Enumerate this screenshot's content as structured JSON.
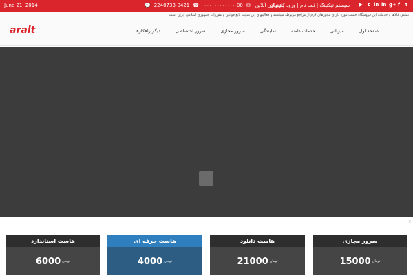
{
  "topbar": {
    "date": "June 21, 2014",
    "support": "پشتیبانی آنلاین",
    "phone": "00-۰۰۰۰۰۰۰۰۰۰۰۰",
    "phone2": "0421-2240733",
    "login": "سیستم تیکتینگ | ثبت نام | ورود کاربران",
    "social_icons": [
      "youtube-icon",
      "tumblr-icon",
      "linkedin-icon",
      "linkedin-icon",
      "google-plus-icon",
      "facebook-icon",
      "twitter-icon"
    ],
    "color": "#d9252b"
  },
  "header": {
    "notice": "تمامی کالاها و خدمات این فروشگاه حسب مورد دارای مجوزهای لازم از مراجع مربوطه میباشند و فعالیتهای این سایت تابع قوانین و مقررات جمهوری اسلامی ایران است",
    "logo_text": "aralt",
    "nav": [
      "صفحه اول",
      "میزبانی",
      "خدمات دامنه",
      "نمایندگی",
      "سرور مجازی",
      "سرور اختصاصی",
      "دیگر راهکارها"
    ]
  },
  "slider": {
    "background": "#3c3c3c"
  },
  "plans": [
    {
      "title": "هاست استاندارد",
      "amount": "6000",
      "unit": "تومان"
    },
    {
      "title": "هاست حرفه ای",
      "amount": "4000",
      "unit": "تومان"
    },
    {
      "title": "هاست دانلود",
      "amount": "21000",
      "unit": "تومان"
    },
    {
      "title": "سرور مجازی",
      "amount": "15000",
      "unit": "تومان"
    }
  ]
}
